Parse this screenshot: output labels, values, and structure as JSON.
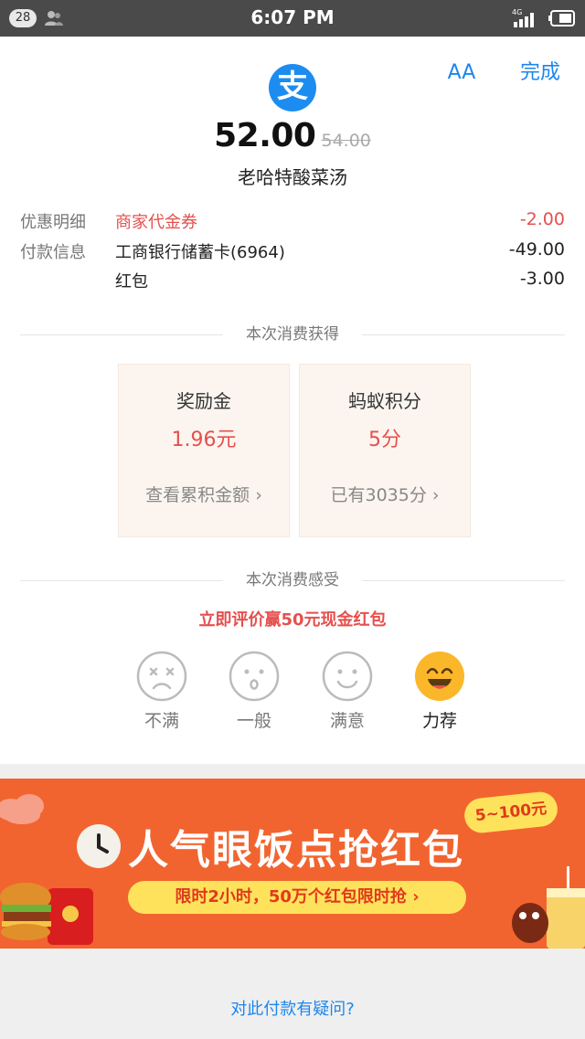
{
  "status_bar": {
    "notification_count": "28",
    "time": "6:07 PM",
    "network": "4G"
  },
  "header": {
    "logo_char": "支",
    "aa_label": "AA",
    "done_label": "完成"
  },
  "payment": {
    "amount": "52.00",
    "original_amount": "54.00",
    "merchant": "老哈特酸菜汤"
  },
  "details": {
    "discount_label": "优惠明细",
    "discount_desc": "商家代金券",
    "discount_value": "-2.00",
    "payment_label": "付款信息",
    "payments": [
      {
        "desc": "工商银行储蓄卡(6964)",
        "value": "-49.00"
      },
      {
        "desc": "红包",
        "value": "-3.00"
      }
    ]
  },
  "rewards": {
    "section_title": "本次消费获得",
    "cards": [
      {
        "title": "奖励金",
        "value": "1.96元",
        "link": "查看累积金额 ›"
      },
      {
        "title": "蚂蚁积分",
        "value": "5分",
        "link": "已有3035分 ›"
      }
    ]
  },
  "feedback": {
    "section_title": "本次消费感受",
    "promo": "立即评价赢50元现金红包",
    "options": [
      "不满",
      "一般",
      "满意",
      "力荐"
    ]
  },
  "banner": {
    "title": "人气眼饭点抢红包",
    "subtitle": "限时2小时，50万个红包限时抢 ›",
    "tag": "5~100元"
  },
  "footer": {
    "question": "对此付款有疑问?"
  },
  "colors": {
    "accent_blue": "#1c86ee",
    "logo_blue": "#1d8cf0",
    "red": "#e5504e",
    "banner_orange": "#f2642f",
    "banner_yellow": "#ffe25c"
  }
}
